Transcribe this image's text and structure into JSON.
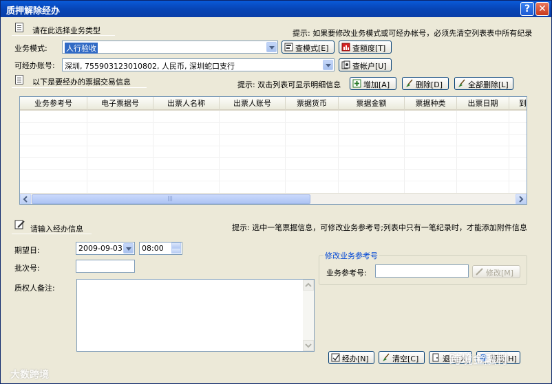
{
  "window": {
    "title": "质押解除经办",
    "help_glyph": "?",
    "close_glyph": "✕"
  },
  "section1": {
    "title": "请在此选择业务类型",
    "hint": "提示: 如果要修改业务模式或可经办帐号，必须先清空列表表中所有纪录"
  },
  "business_mode": {
    "label": "业务模式:",
    "value": "人行验收"
  },
  "account": {
    "label": "可经办账号:",
    "value": "深圳, 755903123010802, 人民币, 深圳蛇口支行"
  },
  "buttons_top": {
    "check_mode": "查模式[E]",
    "check_limit": "查额度[T]",
    "check_account": "查帐户[U]"
  },
  "section2": {
    "title": "以下是要经办的票据交易信息",
    "hint": "提示: 双击列表可显示明细信息",
    "add": "增加[A]",
    "delete": "删除[D]",
    "delete_all": "全部删除[L]"
  },
  "table": {
    "columns": [
      "业务参考号",
      "电子票据号",
      "出票人名称",
      "出票人账号",
      "票据货币",
      "票据金额",
      "票据种类",
      "出票日期",
      "到"
    ],
    "rows": [],
    "scroll_grip": "|||"
  },
  "section3": {
    "title": "请输入经办信息",
    "hint": "提示: 选中一笔票据信息，可修改业务参考号;列表中只有一笔纪录时，才能添加附件信息"
  },
  "form": {
    "expect_date_label": "期望日:",
    "expect_date_value": "2009-09-03",
    "expect_time_value": "08:00",
    "batch_label": "批次号:",
    "batch_value": "",
    "remark_label": "质权人备注:",
    "remark_value": ""
  },
  "modify_group": {
    "title": "修改业务参考号",
    "ref_label": "业务参考号:",
    "ref_value": "",
    "modify_button": "修改[M]"
  },
  "buttons_bottom": {
    "process": "经办[N]",
    "clear": "清空[C]",
    "exit": "退出[X]",
    "help": "帮助[H]"
  },
  "watermarks": {
    "left": "大数跨境",
    "right": "跨境金融村"
  }
}
